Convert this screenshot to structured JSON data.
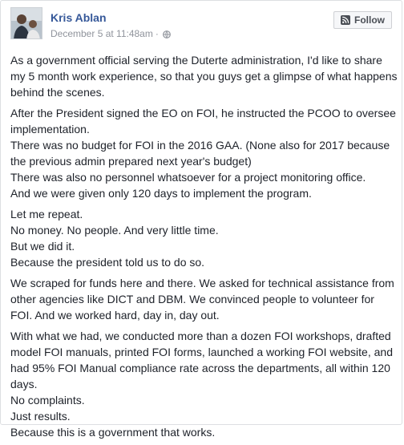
{
  "post": {
    "author": "Kris Ablan",
    "timestamp": "December 5 at 11:48am",
    "separator": "·",
    "privacy_icon": "globe-icon",
    "follow_label": "Follow",
    "follow_icon": "rss-icon",
    "paragraphs": [
      [
        "As a government official serving the Duterte administration, I'd like to share my 5 month work experience, so that you guys get a glimpse of what happens behind the scenes."
      ],
      [
        "After the President signed the EO on FOI, he instructed the PCOO to oversee implementation.",
        "There was no budget for FOI in the 2016 GAA. (None also for 2017 because the previous admin prepared next year's budget)",
        "There was also no personnel whatsoever for a project monitoring office.",
        "And we were given only 120 days to implement the program."
      ],
      [
        "Let me repeat.",
        "No money. No people. And very little time.",
        "But we did it.",
        "Because the president told us to do so."
      ],
      [
        "We scraped for funds here and there. We asked for technical assistance from other agencies like DICT and DBM. We convinced people to volunteer for FOI. And we worked hard, day in, day out."
      ],
      [
        "With what we had, we conducted more than a dozen FOI workshops, drafted model FOI manuals, printed FOI forms, launched a working FOI website, and had 95% FOI Manual compliance rate across the departments, all within 120 days.",
        "No complaints.",
        "Just results.",
        "Because this is a government that works."
      ]
    ]
  },
  "colors": {
    "author_link": "#365899",
    "meta_text": "#90949c",
    "body_text": "#1d2129",
    "border": "#dddfe2",
    "button_bg": "#f6f7f9"
  }
}
